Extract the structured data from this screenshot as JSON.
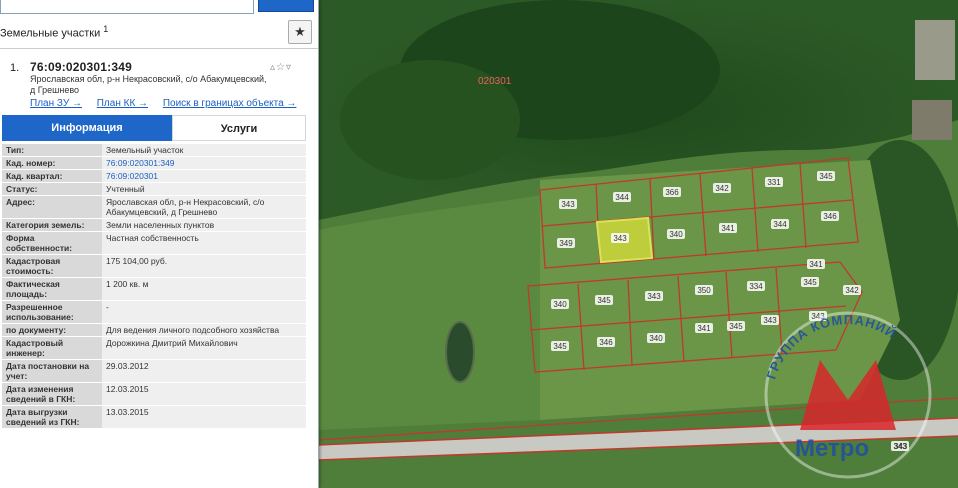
{
  "panel": {
    "title": "Земельные участки",
    "title_sup": "1",
    "star_icon": "★",
    "card": {
      "number": "1.",
      "cadastral_number": "76:09:020301:349",
      "address": "Ярославская обл, р-н Некрасовский, с/о Абакумцевский, д Грешнево",
      "links": [
        "План ЗУ →",
        "План КК →",
        "Поиск в границах объекта →"
      ]
    },
    "tabs": {
      "info": "Информация",
      "services": "Услуги"
    },
    "rows": [
      {
        "key": "Тип:",
        "value": "Земельный участок"
      },
      {
        "key": "Кад. номер:",
        "value": "76:09:020301:349"
      },
      {
        "key": "Кад. квартал:",
        "value": "76:09:020301"
      },
      {
        "key": "Статус:",
        "value": "Учтенный"
      },
      {
        "key": "Адрес:",
        "value": "Ярославская обл, р-н Некрасовский, с/о Абакумцевский, д Грешнево"
      },
      {
        "key": "Категория земель:",
        "value": "Земли населенных пунктов"
      },
      {
        "key": "Форма собственности:",
        "value": "Частная собственность"
      },
      {
        "key": "Кадастровая стоимость:",
        "value": "175 104,00 руб."
      },
      {
        "key": "Фактическая площадь:",
        "value": "1 200 кв. м"
      },
      {
        "key": "Разрешенное использование:",
        "value": "-"
      },
      {
        "key": "по документу:",
        "value": "Для ведения личного подсобного хозяйства"
      },
      {
        "key": "Кадастровый инженер:",
        "value": "Дорожкина Дмитрий Михайлович"
      },
      {
        "key": "Дата постановки на учет:",
        "value": "29.03.2012"
      },
      {
        "key": "Дата изменения сведений в ГКН:",
        "value": "12.03.2015"
      },
      {
        "key": "Дата выгрузки сведений из ГКН:",
        "value": "13.03.2015"
      }
    ]
  },
  "map": {
    "quarter_label": "020301",
    "parcels": [
      "343",
      "344",
      "366",
      "342",
      "331",
      "345",
      "349",
      "343",
      "340",
      "341",
      "344",
      "346",
      "340",
      "345",
      "343",
      "350",
      "334",
      "345",
      "345",
      "346",
      "340",
      "341",
      "345",
      "343",
      "342",
      "341",
      "343",
      "343"
    ],
    "watermark_arc": "ГРУППА КОМПАНИЙ",
    "watermark_name": "Метро",
    "corner_label": "343"
  },
  "colors": {
    "accent": "#1e66c8",
    "boundary": "#c0392b",
    "selected": "#c7d43a"
  }
}
